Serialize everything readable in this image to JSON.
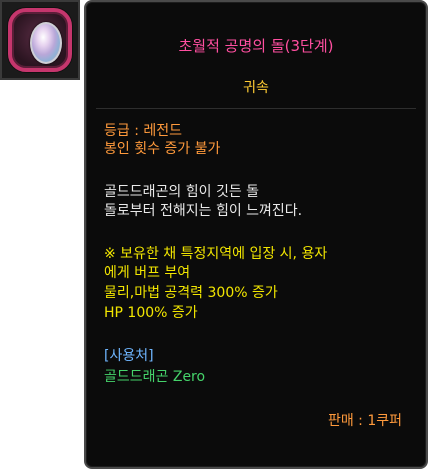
{
  "item": {
    "name": "초월적 공명의 돌(3단계)",
    "binding": "귀속",
    "grade_label": "등급 : 레전드",
    "seal_text": "봉인 횟수 증가 불가",
    "description": [
      "골드드래곤의 힘이 깃든 돌",
      "돌로부터 전해지는 힘이 느껴진다."
    ],
    "effect": [
      "※ 보유한 채 특정지역에 입장 시, 용자",
      "에게 버프 부여",
      "물리,마법 공격력 300% 증가",
      "HP 100% 증가"
    ],
    "usage_header": "[사용처]",
    "usage_value": "골드드래곤 Zero",
    "sell": "판매 : 1쿠퍼"
  },
  "colors": {
    "title": "#ff4fa0",
    "binding": "#ffcc33",
    "grade": "#ff9a3c",
    "effect": "#f2e600",
    "usage_header": "#6fb6ff",
    "usage_value": "#45d36a"
  },
  "icons": {
    "item_icon": "resonance-stone-icon"
  }
}
